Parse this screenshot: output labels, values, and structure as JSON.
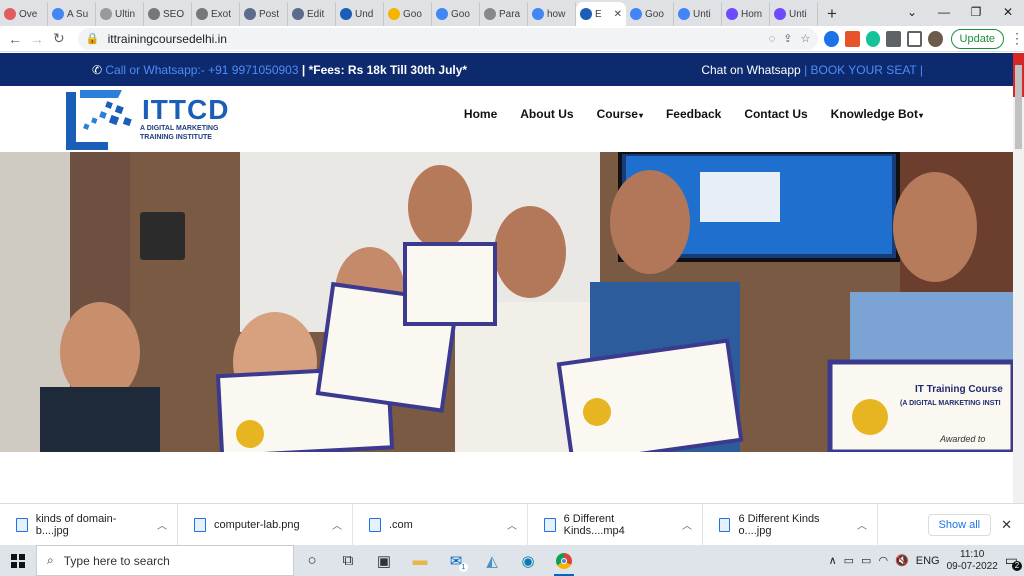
{
  "browser": {
    "tabs": [
      {
        "label": "Ove",
        "color": "#e05d5d"
      },
      {
        "label": "A Su",
        "color": "#4285f4"
      },
      {
        "label": "Ultin",
        "color": "#999999"
      },
      {
        "label": "SEO",
        "color": "#777777"
      },
      {
        "label": "Exot",
        "color": "#777777"
      },
      {
        "label": "Post",
        "color": "#5b6b8c"
      },
      {
        "label": "Edit",
        "color": "#5b6b8c"
      },
      {
        "label": "Und",
        "color": "#1a5eb8"
      },
      {
        "label": "Goo",
        "color": "#f4b400"
      },
      {
        "label": "Goo",
        "color": "#4285f4"
      },
      {
        "label": "Para",
        "color": "#888888"
      },
      {
        "label": "how",
        "color": "#4285f4"
      },
      {
        "label": "E",
        "color": "#1a5eb8",
        "active": true
      },
      {
        "label": "Goo",
        "color": "#4285f4"
      },
      {
        "label": "Unti",
        "color": "#4285f4"
      },
      {
        "label": "Hom",
        "color": "#6d4aff"
      },
      {
        "label": "Unti",
        "color": "#6d4aff"
      }
    ],
    "url": "ittrainingcoursedelhi.in",
    "update_label": "Update"
  },
  "site": {
    "topbar_left": "Call or Whatsapp:- +91 9971050903",
    "topbar_fees": "| *Fees: Rs 18k Till 30th July*",
    "topbar_chat": "Chat on Whatsapp",
    "topbar_seat": "| BOOK YOUR SEAT |",
    "brand": "ITTCD",
    "brand_tagline": "A DIGITAL MARKETING TRAINING INSTITUTE",
    "menu": [
      "Home",
      "About Us",
      "Course",
      "Feedback",
      "Contact Us",
      "Knowledge Bot"
    ],
    "cert_heading": "IT Training Course",
    "cert_sub": "(A DIGITAL MARKETING INSTI",
    "cert_awarded": "Awarded to",
    "brand_blue": "#0d2a6e",
    "accent_blue": "#4f8cf5"
  },
  "downloads": {
    "items": [
      "kinds of domain- b....jpg",
      "computer-lab.png",
      ".com",
      "6 Different Kinds....mp4",
      "6 Different Kinds o....jpg"
    ],
    "show_all": "Show all"
  },
  "taskbar": {
    "search_placeholder": "Type here to search",
    "mail_badge": "1",
    "lang": "ENG",
    "time": "11:10",
    "date": "09-07-2022",
    "notif_count": "2"
  }
}
